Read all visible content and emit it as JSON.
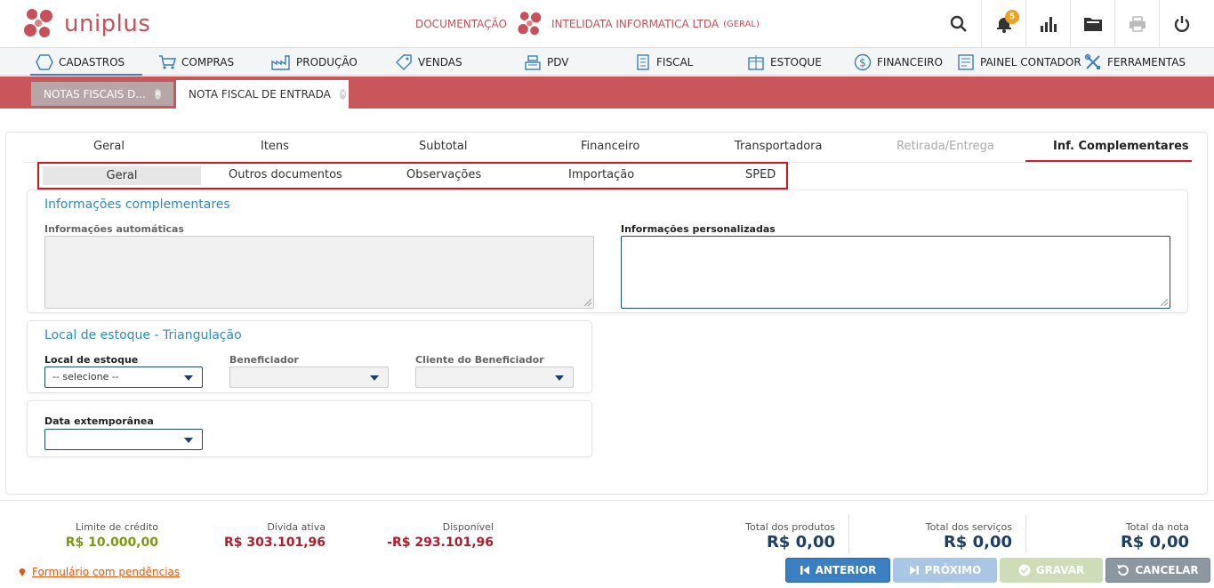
{
  "app": {
    "logo_text": "uniplus"
  },
  "header": {
    "module": "DOCUMENTAÇÃO",
    "company": "INTELIDATA INFORMATICA LTDA",
    "company_suffix": "(GERAL)",
    "notification_count": "5"
  },
  "menu": [
    {
      "label": "CADASTROS",
      "icon": "hexagon-icon"
    },
    {
      "label": "COMPRAS",
      "icon": "cart-icon"
    },
    {
      "label": "PRODUÇÃO",
      "icon": "factory-icon"
    },
    {
      "label": "VENDAS",
      "icon": "tag-icon"
    },
    {
      "label": "PDV",
      "icon": "cash-register-icon"
    },
    {
      "label": "FISCAL",
      "icon": "document-icon"
    },
    {
      "label": "ESTOQUE",
      "icon": "box-icon"
    },
    {
      "label": "FINANCEIRO",
      "icon": "dollar-icon"
    },
    {
      "label": "PAINEL CONTADOR",
      "icon": "ledger-icon"
    },
    {
      "label": "FERRAMENTAS",
      "icon": "tools-icon"
    }
  ],
  "doc_tabs": [
    {
      "label": "NOTAS FISCAIS D..."
    },
    {
      "label": "NOTA FISCAL DE ENTRADA"
    }
  ],
  "primary_tabs": [
    "Geral",
    "Itens",
    "Subtotal",
    "Financeiro",
    "Transportadora",
    "Retirada/Entrega",
    "Inf. Complementares"
  ],
  "sub_tabs": [
    "Geral",
    "Outros documentos",
    "Observações",
    "Importação",
    "SPED"
  ],
  "info_section": {
    "title": "Informações complementares",
    "auto_label": "Informações automáticas",
    "custom_label": "Informações personalizadas"
  },
  "stock_section": {
    "title": "Local de estoque - Triangulação",
    "local_label": "Local de estoque",
    "local_value": "-- selecione --",
    "benef_label": "Beneficiador",
    "client_label": "Cliente do Beneficiador"
  },
  "date_section": {
    "label": "Data extemporânea"
  },
  "summary": {
    "credit_label": "Limite de crédito",
    "credit_value": "R$ 10.000,00",
    "debt_label": "Dívida ativa",
    "debt_value": "R$ 303.101,96",
    "available_label": "Disponível",
    "available_value": "-R$ 293.101,96",
    "products_label": "Total dos produtos",
    "products_value": "R$ 0,00",
    "services_label": "Total dos serviços",
    "services_value": "R$ 0,00",
    "note_label": "Total da nota",
    "note_value": "R$ 0,00"
  },
  "footer": {
    "pending": "Formulário com pendências",
    "prev": "ANTERIOR",
    "next": "PRÓXIMO",
    "save": "GRAVAR",
    "cancel": "CANCELAR"
  },
  "colors": {
    "brand": "#c8505a",
    "accent_blue": "#2f8bc4",
    "credit_green": "#7a9a10",
    "debt_red": "#b01c2a"
  }
}
